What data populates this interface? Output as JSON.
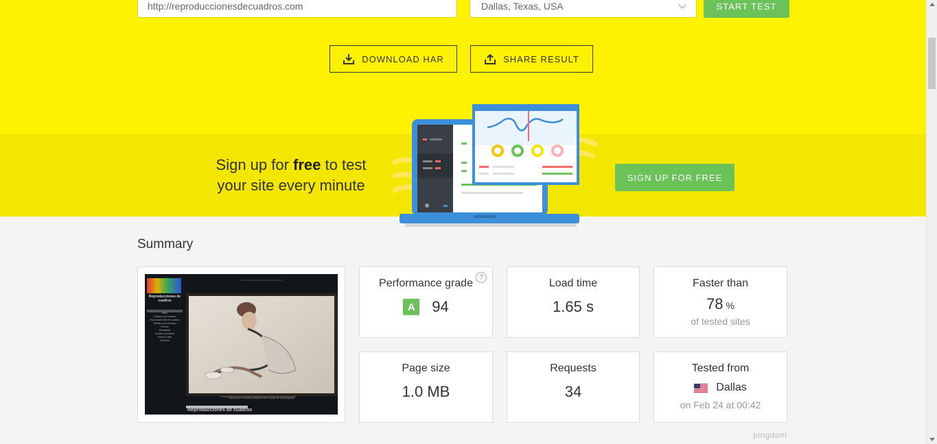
{
  "test_form": {
    "url_value": "http://reproduccionesdecuadros.com",
    "location_value": "Dallas, Texas, USA",
    "start_label": "START TEST"
  },
  "actions": {
    "download_har_label": "DOWNLOAD HAR",
    "share_result_label": "SHARE RESULT"
  },
  "promo": {
    "line1_prefix": "Sign up for ",
    "line1_bold": "free",
    "line1_suffix": " to test",
    "line2": "your site every minute",
    "button_label": "SIGN UP FOR FREE"
  },
  "summary": {
    "title": "Summary",
    "performance": {
      "label": "Performance grade",
      "grade": "A",
      "score": "94",
      "help": "?"
    },
    "load_time": {
      "label": "Load time",
      "value": "1.65 s"
    },
    "faster_than": {
      "label": "Faster than",
      "value": "78",
      "unit": "%",
      "sub": "of tested sites"
    },
    "page_size": {
      "label": "Page size",
      "value": "1.0 MB"
    },
    "requests": {
      "label": "Requests",
      "value": "34"
    },
    "tested_from": {
      "label": "Tested from",
      "city": "Dallas",
      "date": "on Feb 24 at 00:42",
      "flag_icon": "us-flag-icon"
    }
  },
  "screenshot": {
    "site_logo_text": "Reproducciones de cuadros",
    "menu": [
      "Inicio",
      "Cuadros por encargo",
      "Reproducciones de cuadros",
      "Retratos por encargo",
      "Precios",
      "Actualidad",
      "Cuadros vendidos",
      "Sobre el sitio",
      "Contacto"
    ],
    "caption": "Réplica de un cuadro pintado al óleo a partir de una fotografía",
    "footer_title": "Reproducciones de cuadros"
  },
  "branding": {
    "pingdom": "pingdom"
  },
  "colors": {
    "hero_yellow": "#fff200",
    "band_yellow": "#f3e600",
    "accent_green": "#6ac259",
    "page_bg": "#f4f4f4"
  }
}
